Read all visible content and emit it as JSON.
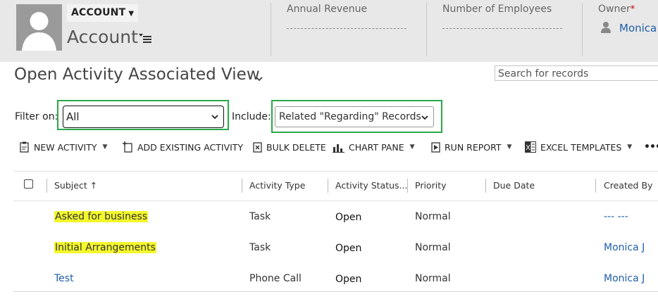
{
  "header": {
    "entity_type": "ACCOUNT",
    "record_name": "Account",
    "fields": [
      {
        "label": "Annual Revenue",
        "value": ""
      },
      {
        "label": "Number of Employees",
        "value": ""
      },
      {
        "label": "Owner",
        "required_mark": "*",
        "value": "Monica"
      }
    ]
  },
  "view": {
    "title": "Open Activity Associated View",
    "search_placeholder": "Search for records"
  },
  "filters": {
    "filter_label": "Filter on:",
    "filter_value": "All",
    "include_label": "Include:",
    "include_value": "Related \"Regarding\" Records"
  },
  "commands": [
    {
      "label": "NEW ACTIVITY",
      "icon": "new-activity-icon",
      "dropdown": true
    },
    {
      "label": "ADD EXISTING ACTIVITY",
      "icon": "add-existing-icon",
      "dropdown": false
    },
    {
      "label": "BULK DELETE",
      "icon": "bulk-delete-icon",
      "dropdown": false
    },
    {
      "label": "CHART PANE",
      "icon": "chart-pane-icon",
      "dropdown": true
    },
    {
      "label": "RUN REPORT",
      "icon": "run-report-icon",
      "dropdown": true
    },
    {
      "label": "EXCEL TEMPLATES",
      "icon": "excel-icon",
      "dropdown": true
    },
    {
      "label": "•••",
      "icon": "more-icon",
      "dropdown": false
    }
  ],
  "grid": {
    "columns": [
      "Subject",
      "Activity Type",
      "Activity Status...",
      "Priority",
      "Due Date",
      "Created By"
    ],
    "sort_indicator": "↑",
    "rows": [
      {
        "subject": "Asked for business",
        "activity_type": "Task",
        "status": "Open",
        "priority": "Normal",
        "due_date": "",
        "created_by": "--- ---",
        "highlighted": true
      },
      {
        "subject": "Initial Arrangements",
        "activity_type": "Task",
        "status": "Open",
        "priority": "Normal",
        "due_date": "",
        "created_by": "Monica J",
        "highlighted": true
      },
      {
        "subject": "Test",
        "activity_type": "Phone Call",
        "status": "Open",
        "priority": "Normal",
        "due_date": "",
        "created_by": "Monica J",
        "highlighted": false
      }
    ]
  },
  "colors": {
    "highlight": "#f4f82b",
    "annotation_box": "#2aa84a",
    "link": "#1f5fa8"
  }
}
